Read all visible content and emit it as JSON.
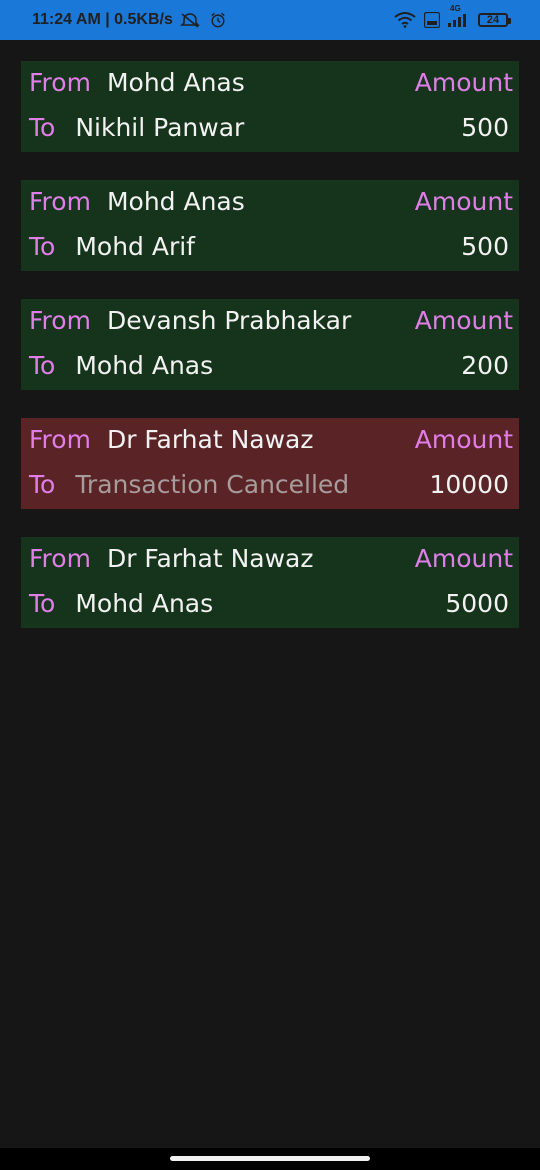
{
  "status_bar": {
    "time_speed": "11:24 AM | 0.5KB/s",
    "network_label": "4G",
    "battery": "24"
  },
  "labels": {
    "from": "From",
    "to": "To",
    "amount": "Amount"
  },
  "transactions": [
    {
      "from": "Mohd Anas",
      "to": "Nikhil Panwar",
      "amount": "500",
      "status": "completed"
    },
    {
      "from": "Mohd Anas",
      "to": "Mohd Arif",
      "amount": "500",
      "status": "completed"
    },
    {
      "from": "Devansh Prabhakar",
      "to": "Mohd Anas",
      "amount": "200",
      "status": "completed"
    },
    {
      "from": "Dr Farhat Nawaz",
      "to": "Transaction Cancelled",
      "amount": "10000",
      "status": "cancelled"
    },
    {
      "from": "Dr Farhat Nawaz",
      "to": "Mohd Anas",
      "amount": "5000",
      "status": "completed"
    }
  ],
  "colors": {
    "status_bar": "#1a78d8",
    "card_completed": "#15341b",
    "card_cancelled": "#5a2427",
    "label_accent": "#e07ee8",
    "background": "#161616"
  }
}
